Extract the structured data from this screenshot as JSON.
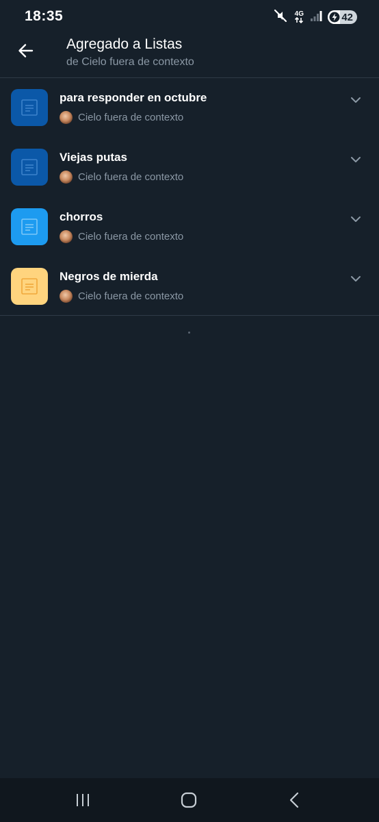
{
  "status_bar": {
    "time": "18:35",
    "network": "4G",
    "battery_level": "42",
    "battery_fraction": 0.42,
    "icons": [
      "mute-icon",
      "network-4g-icon",
      "signal-icon",
      "battery-charging-icon"
    ]
  },
  "header": {
    "title": "Agregado a Listas",
    "subtitle": "de Cielo fuera de contexto",
    "back_icon": "back-arrow-icon"
  },
  "lists": [
    {
      "name": "para responder en octubre",
      "owner": "Cielo fuera de contexto",
      "icon_color": "#0b58a8",
      "glyph_color": "#3c82cc"
    },
    {
      "name": "Viejas putas",
      "owner": "Cielo fuera de contexto",
      "icon_color": "#0b58a8",
      "glyph_color": "#3c82cc"
    },
    {
      "name": "chorros",
      "owner": "Cielo fuera de contexto",
      "icon_color": "#1d9bf0",
      "glyph_color": "#7cc7f7"
    },
    {
      "name": "Negros de mierda",
      "owner": "Cielo fuera de contexto",
      "icon_color": "#ffd47e",
      "glyph_color": "#f0a83a"
    }
  ],
  "nav": {
    "icons": [
      "recent-apps-icon",
      "home-icon",
      "back-icon"
    ]
  },
  "colors": {
    "background": "#16202a",
    "divider": "#2f3b47",
    "secondary_text": "#8b98a5",
    "nav_background": "#10171e"
  }
}
